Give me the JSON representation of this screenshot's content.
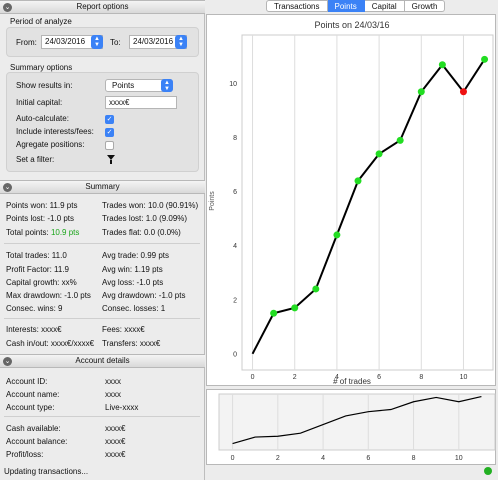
{
  "report_options": {
    "header": "Report options",
    "period": {
      "label": "Period of analyze",
      "from_label": "From:",
      "from_value": "24/03/2016",
      "to_label": "To:",
      "to_value": "24/03/2016"
    },
    "summary": {
      "label": "Summary options",
      "show_results_label": "Show results in:",
      "show_results_value": "Points",
      "initial_capital_label": "Initial capital:",
      "initial_capital_value": "xxxx€",
      "auto_calculate_label": "Auto-calculate:",
      "auto_calculate": true,
      "include_interests_label": "Include interests/fees:",
      "include_interests": true,
      "agregate_label": "Agregate positions:",
      "agregate": false,
      "filter_label": "Set a filter:"
    }
  },
  "summary": {
    "header": "Summary",
    "points_won": "Points won: 11.9 pts",
    "trades_won": "Trades won: 10.0 (90.91%)",
    "points_lost": "Points lost: -1.0 pts",
    "trades_lost": "Trades lost: 1.0 (9.09%)",
    "total_points_label": "Total points:",
    "total_points_value": "10.9 pts",
    "trades_flat": "Trades flat: 0.0 (0.0%)",
    "total_trades": "Total trades: 11.0",
    "avg_trade": "Avg trade: 0.99 pts",
    "profit_factor": "Profit Factor: 11.9",
    "avg_win": "Avg win: 1.19 pts",
    "capital_growth": "Capital growth: xx%",
    "avg_loss": "Avg loss: -1.0 pts",
    "max_drawdown": "Max drawdown: -1.0 pts",
    "avg_drawdown": "Avg drawdown: -1.0 pts",
    "consec_wins": "Consec. wins: 9",
    "consec_losses": "Consec. losses: 1",
    "interests": "Interests: xxxx€",
    "fees": "Fees: xxxx€",
    "cash_in_out": "Cash in/out: xxxx€/xxxx€",
    "transfers": "Transfers: xxxx€"
  },
  "account": {
    "header": "Account details",
    "id_label": "Account ID:",
    "id_value": "xxxx",
    "name_label": "Account name:",
    "name_value": "xxxx",
    "type_label": "Account type:",
    "type_value": "Live-xxxx",
    "cash_label": "Cash available:",
    "cash_value": "xxxx€",
    "balance_label": "Account balance:",
    "balance_value": "xxxx€",
    "pl_label": "Profit/loss:",
    "pl_value": "xxxx€"
  },
  "status": "Updating transactions...",
  "tabs": [
    "Transactions",
    "Points",
    "Capital",
    "Growth"
  ],
  "active_tab": "Points",
  "colors": {
    "accent": "#3b82f6",
    "win": "#22dd22",
    "loss": "#ee1111",
    "total_points": "#1aa51a"
  },
  "chart_data": [
    {
      "type": "line",
      "title": "Points on 24/03/16",
      "xlabel": "# of trades",
      "ylabel": "Points",
      "x": [
        0,
        1,
        2,
        3,
        4,
        5,
        6,
        7,
        8,
        9,
        10,
        11
      ],
      "values": [
        0,
        1.5,
        1.7,
        2.4,
        4.4,
        6.4,
        7.4,
        7.9,
        9.7,
        10.7,
        9.7,
        10.9
      ],
      "markers": [
        "none",
        "win",
        "win",
        "win",
        "win",
        "win",
        "win",
        "win",
        "win",
        "win",
        "loss",
        "win"
      ],
      "x_ticks": [
        0,
        2,
        4,
        6,
        8,
        10
      ],
      "y_ticks": [
        0,
        2,
        4,
        6,
        8,
        10
      ],
      "xlim": [
        -0.5,
        11.4
      ],
      "ylim": [
        -0.6,
        11.8
      ],
      "grid": "vertical"
    },
    {
      "type": "line",
      "x": [
        0,
        1,
        2,
        3,
        4,
        5,
        6,
        7,
        8,
        9,
        10,
        11
      ],
      "values": [
        0,
        1.5,
        1.7,
        2.4,
        4.4,
        6.4,
        7.4,
        7.9,
        9.7,
        10.7,
        9.7,
        10.9
      ],
      "x_ticks": [
        0,
        2,
        4,
        6,
        8,
        10
      ],
      "xlim": [
        -0.6,
        11.6
      ],
      "ylim": [
        -1.5,
        11.5
      ],
      "grid": "vertical"
    }
  ]
}
